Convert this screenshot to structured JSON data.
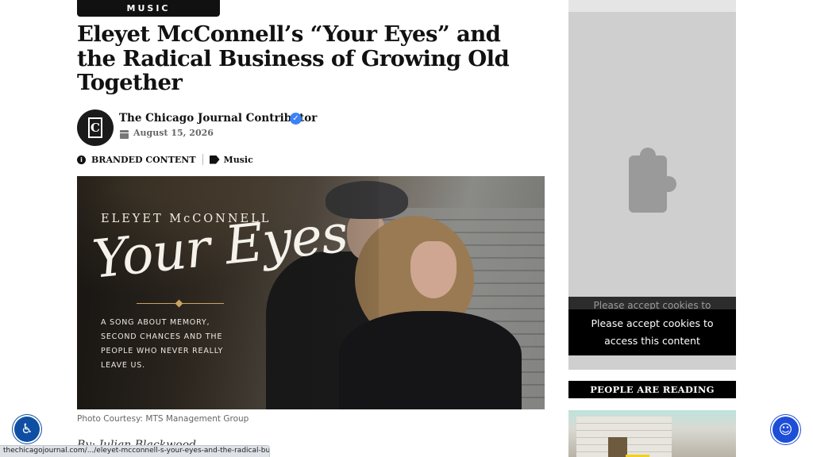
{
  "article": {
    "category": "MUSIC",
    "title": "Eleyet McConnell’s “Your Eyes” and the Radical Business of Growing Old Together",
    "author": {
      "logo_letter": "C",
      "name": "The Chicago Journal Contributor",
      "date": "August 15, 2026"
    },
    "tags": {
      "branded": "BRANDED CONTENT",
      "music": "Music"
    },
    "hero": {
      "artist": "ELEYET McCONNELL",
      "song": "Your Eyes",
      "subtitle": "A SONG ABOUT MEMORY, SECOND CHANCES AND THE PEOPLE WHO NEVER REALLY LEAVE US."
    },
    "caption": "Photo Courtesy: MTS Management Group",
    "byline": "By: Julian Blackwood"
  },
  "sidebar": {
    "cookie_ghost": "Please accept cookies to",
    "cookie_message": "Please accept cookies to access this content",
    "reading_heading": "PEOPLE ARE READING"
  },
  "status_bar": {
    "url": "thechicagojournal.com/.../eleyet-mcconnell-s-your-eyes-and-the-radical-business-..."
  },
  "icons": {
    "verified": "verified-badge-icon",
    "calendar": "calendar-icon",
    "info": "info-icon",
    "tags": "tags-icon",
    "puzzle": "puzzle-icon",
    "a11y_left": "accessibility-widget-icon",
    "a11y_right": "accessibility-icon"
  },
  "colors": {
    "verified": "#3b82f6",
    "fab_left": "#0e4fa3",
    "fab_right": "#1d4ed8"
  }
}
